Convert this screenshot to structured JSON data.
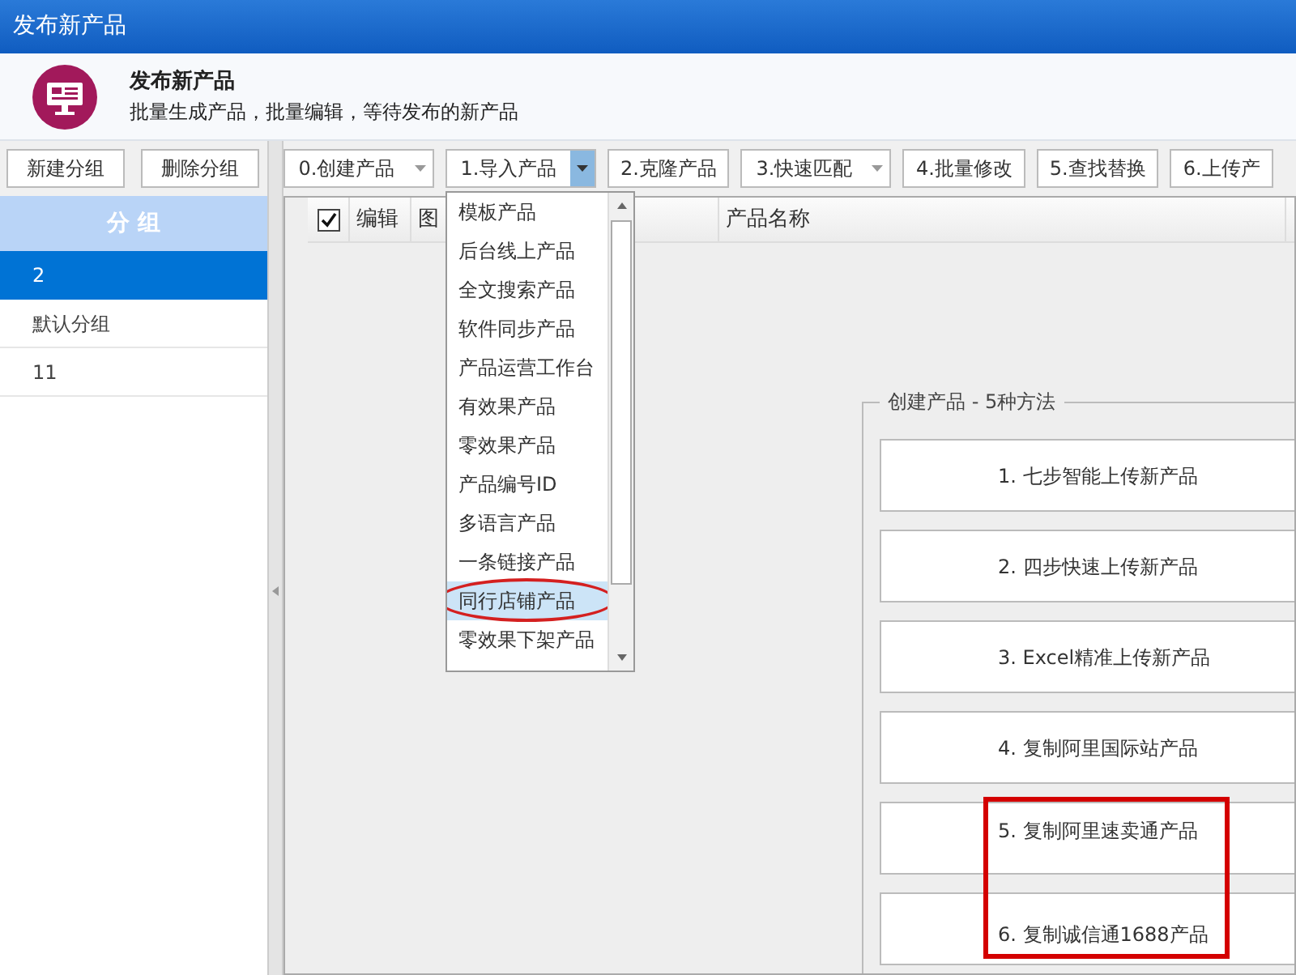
{
  "window": {
    "title": "发布新产品"
  },
  "header": {
    "title": "发布新产品",
    "subtitle": "批量生成产品，批量编辑，等待发布的新产品"
  },
  "group_buttons": [
    "新建分组",
    "删除分组"
  ],
  "groups": {
    "heading": "分 组",
    "items": [
      {
        "label": "2",
        "selected": true
      },
      {
        "label": "默认分组",
        "selected": false
      },
      {
        "label": "11",
        "selected": false
      }
    ]
  },
  "toolbar": [
    {
      "label": "0.创建产品",
      "kind": "dropdown",
      "open": false
    },
    {
      "label": "1.导入产品",
      "kind": "dropdown",
      "open": true
    },
    {
      "label": "2.克隆产品",
      "kind": "button"
    },
    {
      "label": "3.快速匹配",
      "kind": "dropdown",
      "open": false
    },
    {
      "label": "4.批量修改",
      "kind": "button"
    },
    {
      "label": "5.查找替换",
      "kind": "button"
    },
    {
      "label": "6.上传产",
      "kind": "button"
    }
  ],
  "table": {
    "select_all_checked": true,
    "columns": [
      "编辑",
      "图",
      "产品名称"
    ]
  },
  "import_menu": [
    {
      "label": "模板产品",
      "selected": false
    },
    {
      "label": "后台线上产品",
      "selected": false
    },
    {
      "label": "全文搜索产品",
      "selected": false
    },
    {
      "label": "软件同步产品",
      "selected": false
    },
    {
      "label": "产品运营工作台",
      "selected": false
    },
    {
      "label": "有效果产品",
      "selected": false
    },
    {
      "label": "零效果产品",
      "selected": false
    },
    {
      "label": "产品编号ID",
      "selected": false
    },
    {
      "label": "多语言产品",
      "selected": false
    },
    {
      "label": "一条链接产品",
      "selected": false
    },
    {
      "label": "同行店铺产品",
      "selected": true,
      "circled": true
    },
    {
      "label": "零效果下架产品",
      "selected": false
    }
  ],
  "create_methods": {
    "title": "创建产品 - 5种方法",
    "buttons": [
      {
        "label": "1. 七步智能上传新产品",
        "framed": false
      },
      {
        "label": "2. 四步快速上传新产品",
        "framed": false
      },
      {
        "label": "3. Excel精准上传新产品",
        "framed": false
      },
      {
        "label": "4. 复制阿里国际站产品",
        "framed": false
      },
      {
        "label": "5. 复制阿里速卖通产品",
        "framed": true
      },
      {
        "label": "6. 复制诚信通1688产品",
        "framed": true
      }
    ]
  }
}
